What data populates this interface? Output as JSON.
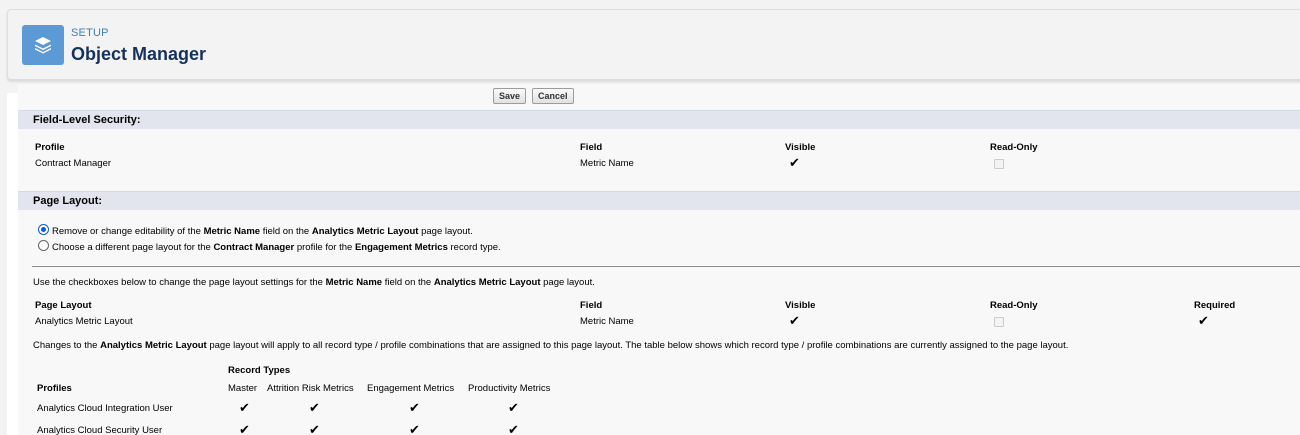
{
  "header": {
    "eyebrow": "SETUP",
    "title": "Object Manager",
    "icon": "layers-icon"
  },
  "toolbar": {
    "save_label": "Save",
    "cancel_label": "Cancel"
  },
  "fls": {
    "section_title": "Field-Level Security:",
    "col_profile": "Profile",
    "col_field": "Field",
    "col_visible": "Visible",
    "col_readonly": "Read-Only",
    "row": {
      "profile": "Contract Manager",
      "field": "Metric Name",
      "visible": true,
      "read_only": false
    }
  },
  "page_layout": {
    "section_title": "Page Layout:",
    "option1": {
      "selected": true,
      "p1": "Remove or change editability of the ",
      "b1": "Metric Name",
      "p2": " field on the ",
      "b2": "Analytics Metric Layout",
      "p3": " page layout."
    },
    "option2": {
      "selected": false,
      "p1": "Choose a different page layout for the ",
      "b1": "Contract Manager",
      "p2": " profile for the ",
      "b2": "Engagement Metrics",
      "p3": " record type."
    },
    "instructions": {
      "p1": "Use the checkboxes below to change the page layout settings for the ",
      "b1": "Metric Name",
      "p2": " field on the ",
      "b2": "Analytics Metric Layout",
      "p3": " page layout."
    },
    "col_layout": "Page Layout",
    "col_field": "Field",
    "col_visible": "Visible",
    "col_readonly": "Read-Only",
    "col_required": "Required",
    "row": {
      "layout": "Analytics Metric Layout",
      "field": "Metric Name",
      "visible": true,
      "read_only": false,
      "required": true
    },
    "changes_note": {
      "p1": "Changes to the ",
      "b1": "Analytics Metric Layout",
      "p2": " page layout will apply to all record type / profile combinations that are assigned to this page layout. The table below shows which record type / profile combinations are currently assigned to the page layout."
    }
  },
  "assignments": {
    "record_types_label": "Record Types",
    "profiles_label": "Profiles",
    "record_types": [
      "Master",
      "Attrition Risk Metrics",
      "Engagement Metrics",
      "Productivity Metrics"
    ],
    "rows": [
      {
        "profile": "Analytics Cloud Integration User",
        "checks": [
          true,
          true,
          true,
          true
        ]
      },
      {
        "profile": "Analytics Cloud Security User",
        "checks": [
          true,
          true,
          true,
          true
        ]
      }
    ]
  }
}
